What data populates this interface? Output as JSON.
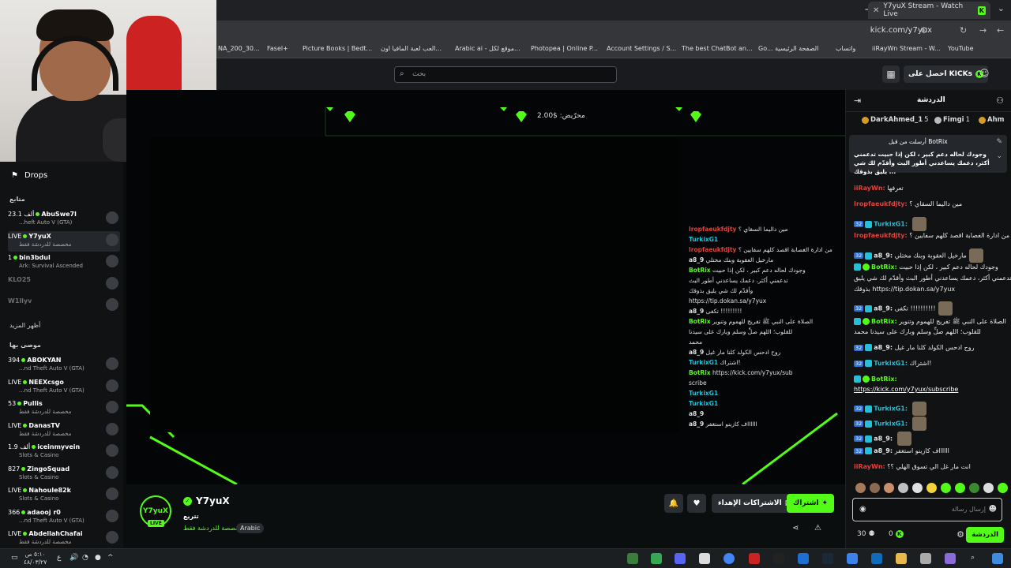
{
  "browser": {
    "tab_title": "Y7yuX Stream - Watch Live",
    "url": "kick.com/y7yux",
    "bookmarks": [
      "YouTube",
      "iiRayWn Stream - W...",
      "واتساب",
      "Go... الصفحة الرئيسية",
      "The best ChatBot an...",
      "Account Settings / S...",
      "Photopea | Online P...",
      "Arabic ai - موقع لكل...",
      "العب لعبة المافيا اون...",
      "Picture Books | Bedt...",
      "Fasel+",
      "NA_200_30..."
    ]
  },
  "header": {
    "search_placeholder": "بحث",
    "get_kicks": "احصل على KICKs"
  },
  "sidebar": {
    "drops": "Drops",
    "following_title": "متابع",
    "following": [
      {
        "status": "23.1 ألف",
        "name": "AbuSwe7l",
        "category": "...heft Auto V (GTA)",
        "live": true
      },
      {
        "status": "LIVE",
        "name": "Y7yuX",
        "category": "مخصصة للدردشة فقط",
        "live": true,
        "active": true
      },
      {
        "status": "1",
        "name": "bin3bdul",
        "category": "Ark: Survival Ascended",
        "live": true
      },
      {
        "status": "",
        "name": "KLO25",
        "category": "",
        "live": false
      },
      {
        "status": "",
        "name": "W1llyv",
        "category": "",
        "live": false
      }
    ],
    "show_more": "أظهر المزيد",
    "recommended_title": "موصى بها",
    "recommended": [
      {
        "status": "394",
        "name": "ABOKYAN",
        "category": "...nd Theft Auto V (GTA)"
      },
      {
        "status": "LIVE",
        "name": "NEEXcsgo",
        "category": "...nd Theft Auto V (GTA)"
      },
      {
        "status": "53",
        "name": "Pullis",
        "category": "مخصصة للدردشة فقط"
      },
      {
        "status": "LIVE",
        "name": "DanasTV",
        "category": "مخصصة للدردشة فقط"
      },
      {
        "status": "1.9 ألف",
        "name": "iceinmyvein",
        "category": "Slots & Casino"
      },
      {
        "status": "827",
        "name": "ZingoSquad",
        "category": "Slots & Casino"
      },
      {
        "status": "LIVE",
        "name": "Nahoule82k",
        "category": "Slots & Casino"
      },
      {
        "status": "366",
        "name": "adaooj r0",
        "category": "...nd Theft Auto V (GTA)"
      },
      {
        "status": "LIVE",
        "name": "AbdellahChafai",
        "category": "مخصصة للدردشة فقط"
      }
    ]
  },
  "video": {
    "engine_label": "محرّيض: $2.00",
    "overlay_chat": [
      {
        "u": "Iropfaeukfdjty",
        "t": "مين داليما السقاي ؟",
        "c": "red"
      },
      {
        "u": "TurkixG1",
        "t": "",
        "c": "cyan"
      },
      {
        "u": "Iropfaeukfdjty",
        "t": "من ادارة الغصابة اقصد كلهم سفايين ؟",
        "c": "red"
      },
      {
        "u": "a8_9",
        "t": "مارخيل العقوبة وبنك مختلي",
        "c": "b"
      },
      {
        "u": "BotRix",
        "t": "وجودك لحاله دعم كبير ، لكن إذا حبيت",
        "c": "green"
      },
      {
        "u": "",
        "t": "تدعمني أكثر، دعمك يساعدني أطور البث",
        "c": ""
      },
      {
        "u": "",
        "t": "وأقدّم لك شي يليق بذوقك",
        "c": ""
      },
      {
        "u": "",
        "t": "https://tip.dokan.sa/y7yux",
        "c": "b"
      },
      {
        "u": "a8_9",
        "t": "تكفى !!!!!!!!!",
        "c": "b"
      },
      {
        "u": "BotRix",
        "t": "الصلاة على النبي ﷺ تفريج للهموم وتنوير",
        "c": "green"
      },
      {
        "u": "",
        "t": "للقلوب؛ اللهم صلِّ وسلم وبارك على سيدنا",
        "c": ""
      },
      {
        "u": "",
        "t": "محمد",
        "c": ""
      },
      {
        "u": "a8_9",
        "t": "روح ادحس الكولد كلنا مار غيل",
        "c": "b"
      },
      {
        "u": "TurkixG1",
        "t": "اشتراك!",
        "c": "cyan"
      },
      {
        "u": "BotRix",
        "t": "https://kick.com/y7yux/sub",
        "c": "green"
      },
      {
        "u": "",
        "t": "scribe",
        "c": "b"
      },
      {
        "u": "TurkixG1",
        "t": "",
        "c": "cyan"
      },
      {
        "u": "TurkixG1",
        "t": "",
        "c": "cyan"
      },
      {
        "u": "a8_9",
        "t": "",
        "c": "b"
      },
      {
        "u": "a8_9",
        "t": "ااااااف كازينو استغفر",
        "c": "b"
      }
    ]
  },
  "stream": {
    "avatar_text": "Y7yuX",
    "live_badge": "LIVE",
    "name": "Y7yuX",
    "title": "تتريع",
    "category": "مخصصة للدردشة فقط",
    "language": "Arabic",
    "subscribe": "اشتراك",
    "gift_subs": "الاشتراكات الإهداء"
  },
  "chat": {
    "title": "الدردشة",
    "gifters": [
      {
        "name": "Ahm",
        "rank": ""
      },
      {
        "name": "Fimgi",
        "rank": "1"
      },
      {
        "name": "DarkAhmed_1",
        "rank": "5"
      }
    ],
    "pinned_header": "أرسلت من قبل BotRix",
    "pinned_text": "وجودك لحاله دعم كبير ، لكن إذا حبيت تدعمني أكثر، دعمك يساعدني أطور البث وأقدّم لك شي يليق بذوقك ...",
    "messages": [
      {
        "u": "iiRayWn:",
        "t": "تعرفها",
        "c": "red",
        "badges": ""
      },
      {
        "u": "Iropfaeukfdjty:",
        "t": "مين داليما السقاي ؟",
        "c": "red",
        "badges": ""
      },
      {
        "u": "TurkixG1:",
        "t": "",
        "c": "cyan",
        "badges": "sub",
        "badge_num": "32",
        "emote": true
      },
      {
        "u": "Iropfaeukfdjty:",
        "t": "من ادارة الغصابة اقصد كلهم سفايين ؟",
        "c": "red",
        "badges": ""
      },
      {
        "u": "a8_9:",
        "t": "مارخيل العقوبة وبنك مختلي",
        "c": "b",
        "badges": "sub",
        "badge_num": "32",
        "emote": true
      },
      {
        "u": "BotRix:",
        "t": "وجودك لحاله دعم كبير ، لكن إذا حبيت",
        "c": "green",
        "badges": "bot"
      },
      {
        "u": "",
        "t": "تدعمني أكثر، دعمك يساعدني أطور البث وأقدّم لك شي يليق",
        "c": "",
        "badges": ""
      },
      {
        "u": "",
        "t": "بذوقك https://tip.dokan.sa/y7yux",
        "c": "",
        "badges": ""
      },
      {
        "u": "a8_9:",
        "t": "تكفى !!!!!!!!!!",
        "c": "b",
        "badges": "sub",
        "badge_num": "32",
        "emote": true
      },
      {
        "u": "BotRix:",
        "t": "الصلاة على النبي ﷺ تفريج للهموم وتنوير",
        "c": "green",
        "badges": "bot"
      },
      {
        "u": "",
        "t": "للقلوب؛ اللهم صلِّ وسلم وبارك على سيدنا محمد",
        "c": "",
        "badges": ""
      },
      {
        "u": "a8_9:",
        "t": "روح ادحس الكولد كلنا مار غيل",
        "c": "b",
        "badges": "sub",
        "badge_num": "32"
      },
      {
        "u": "TurkixG1:",
        "t": "اشتراك!",
        "c": "cyan",
        "badges": "sub",
        "badge_num": "32"
      },
      {
        "u": "BotRix:",
        "t": "",
        "c": "green",
        "badges": "bot"
      },
      {
        "u": "",
        "t": "https://kick.com/y7yux/subscribe",
        "c": "link",
        "badges": ""
      },
      {
        "u": "TurkixG1:",
        "t": "",
        "c": "cyan",
        "badges": "sub",
        "badge_num": "32",
        "emote": true
      },
      {
        "u": "TurkixG1:",
        "t": "",
        "c": "cyan",
        "badges": "sub",
        "badge_num": "32",
        "emote": true
      },
      {
        "u": "a8_9:",
        "t": "",
        "c": "b",
        "badges": "sub",
        "badge_num": "32",
        "emote": true
      },
      {
        "u": "a8_9:",
        "t": "ااااااف كازينو استغفر",
        "c": "b",
        "badges": "sub",
        "badge_num": "32"
      },
      {
        "u": "iiRayWn:",
        "t": "انت مار غل الي تسوق الهلي ؟؟",
        "c": "red",
        "badges": ""
      }
    ],
    "input_placeholder": "إرسال رسالة",
    "send_button": "الدردشة",
    "points": "0",
    "viewers": "30"
  },
  "taskbar": {
    "time": "٥:١٠ ص",
    "date": "٤٨/٠٣/٢٧"
  },
  "colors": {
    "kick_green": "#53fc18",
    "bg": "#0b0e0f",
    "red_user": "#e2403a",
    "cyan_user": "#23c0d8"
  }
}
